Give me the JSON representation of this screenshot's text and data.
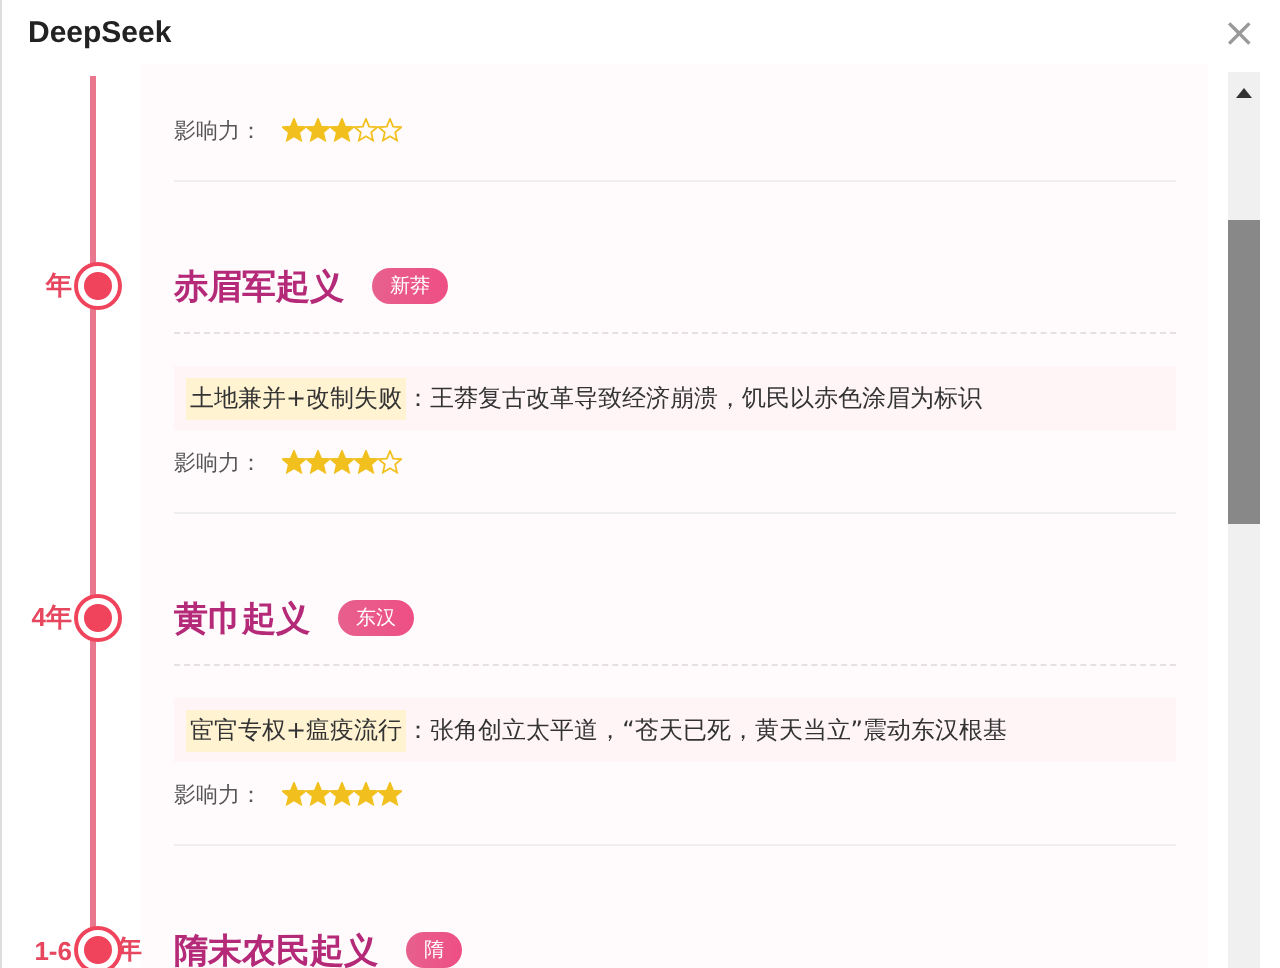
{
  "window": {
    "title": "DeepSeek",
    "close": "×"
  },
  "timeline": [
    {
      "impact_label": "影响力：",
      "stars": 3
    },
    {
      "year": "年",
      "title": "赤眉军起义",
      "badge": "新莽",
      "cause": "土地兼并+改制失败",
      "detail": "：王莽复古改革导致经济崩溃，饥民以赤色涂眉为标识",
      "impact_label": "影响力：",
      "stars": 4
    },
    {
      "year": "4年",
      "title": "黄巾起义",
      "badge": "东汉",
      "cause": "宦官专权+瘟疫流行",
      "detail": "：张角创立太平道，“苍天已死，黄天当立”震动东汉根基",
      "impact_label": "影响力：",
      "stars": 5
    },
    {
      "year": "1-6",
      "year_suffix": "年",
      "title": "隋末农民起义",
      "badge": "隋"
    }
  ]
}
